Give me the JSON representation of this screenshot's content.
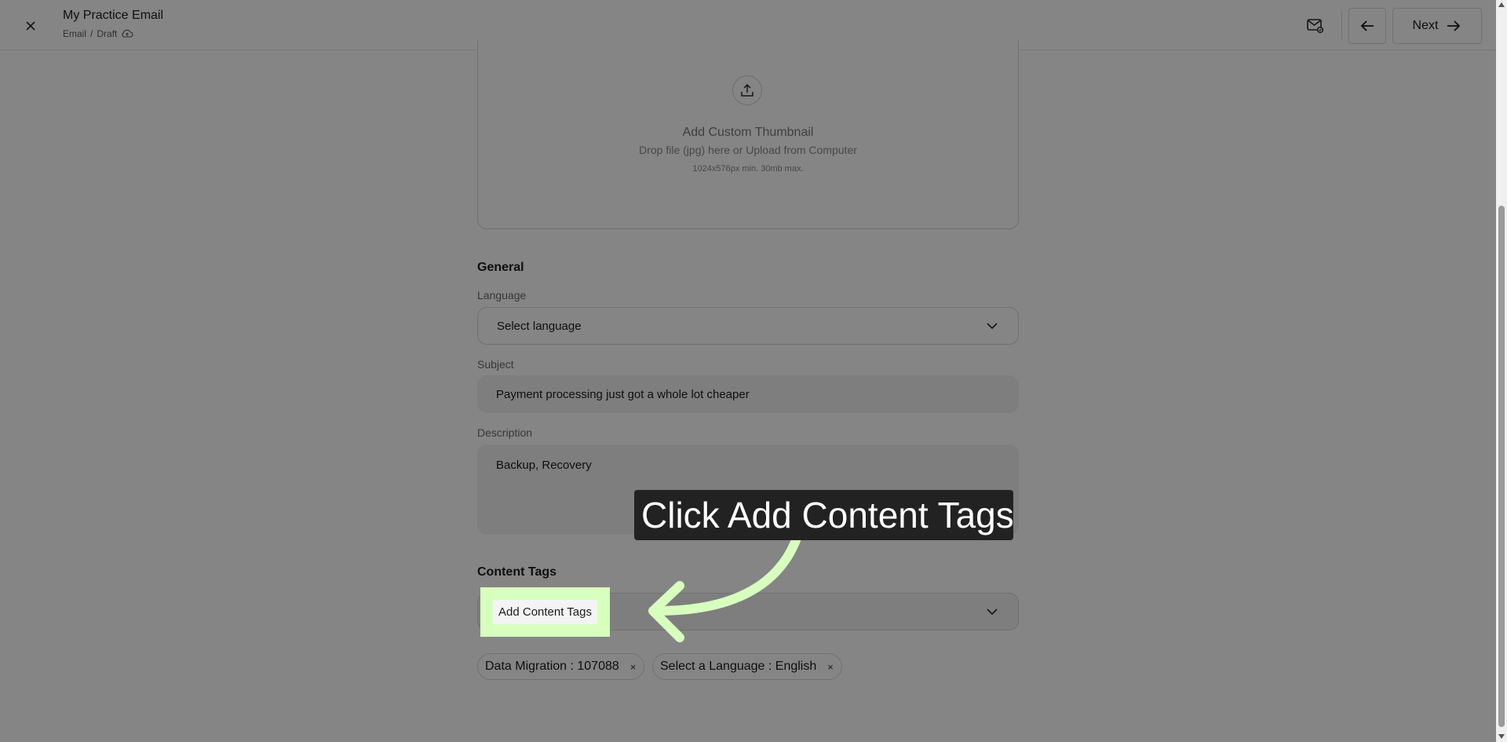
{
  "header": {
    "title": "My Practice Email",
    "breadcrumb": [
      "Email",
      "/",
      "Draft"
    ],
    "next_label": "Next"
  },
  "upload": {
    "title": "Add Custom Thumbnail",
    "subtitle": "Drop file (jpg) here or Upload from Computer",
    "limit": "1024x576px min. 30mb max."
  },
  "general": {
    "heading": "General",
    "language_label": "Language",
    "language_value": "Select language",
    "subject_label": "Subject",
    "subject_value": "Payment processing just got a whole lot cheaper",
    "description_label": "Description",
    "description_value": "Backup, Recovery"
  },
  "content_tags": {
    "heading": "Content Tags",
    "add_label": "Add Content Tags",
    "chips": [
      {
        "label": "Data Migration : 107088",
        "remove": "×"
      },
      {
        "label": "Select a Language : English",
        "remove": "×"
      }
    ]
  },
  "tutorial": {
    "callout": "Click Add Content Tags",
    "highlight_color": "#d7ffbe"
  }
}
